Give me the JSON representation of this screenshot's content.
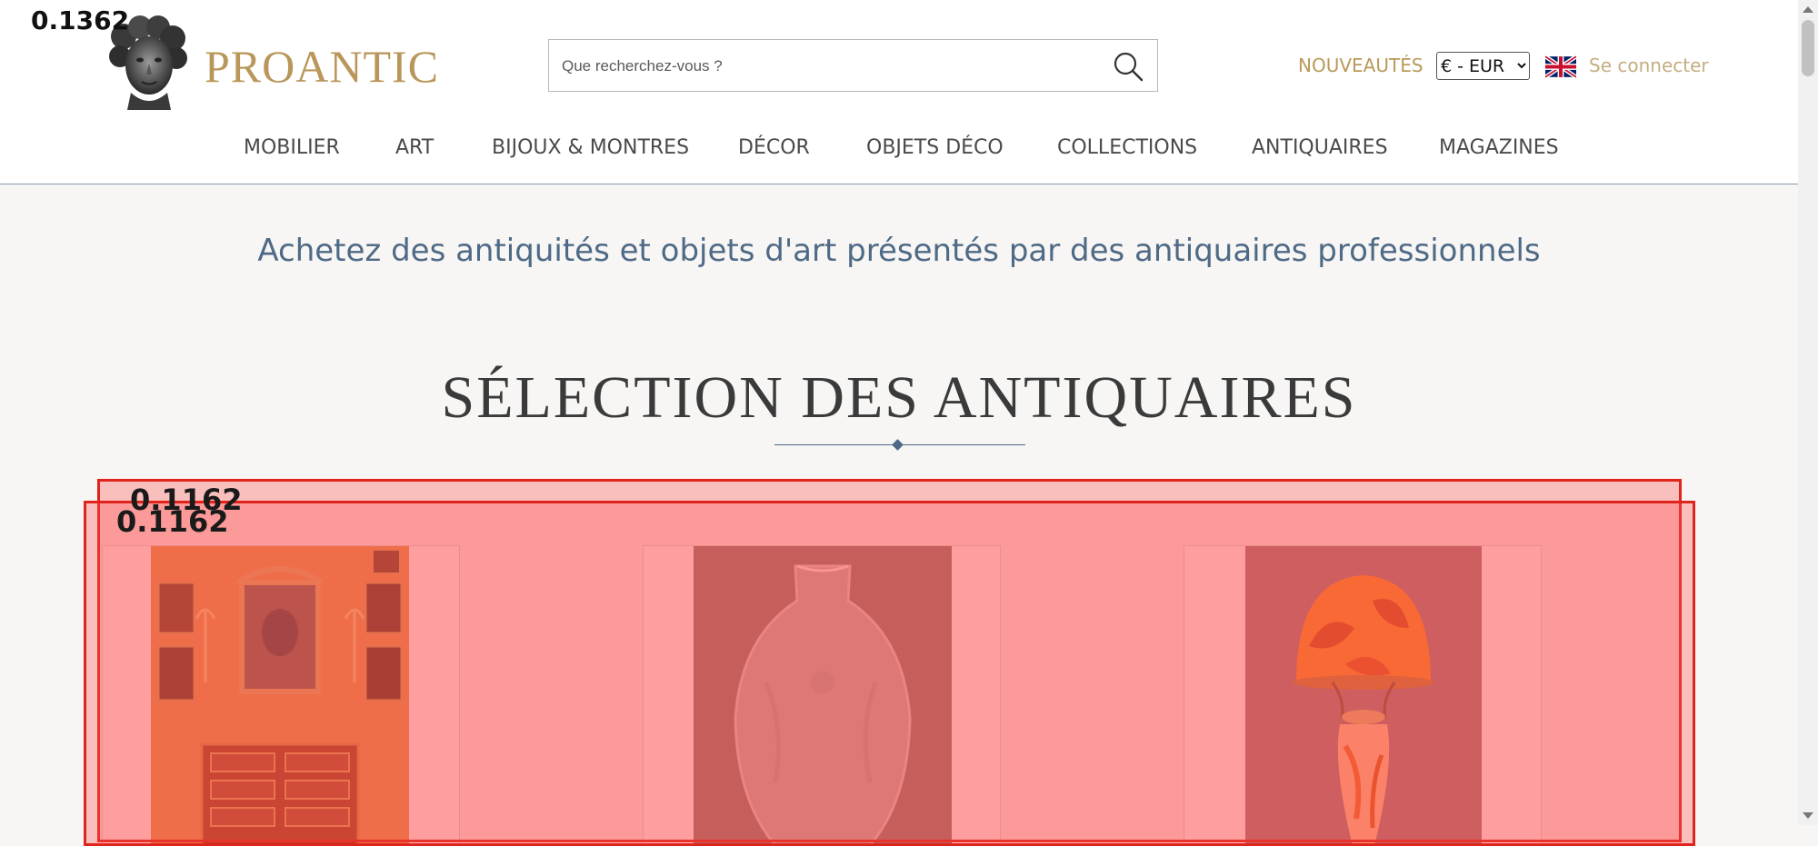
{
  "header": {
    "logo_text": "PROANTIC",
    "search_placeholder": "Que recherchez-vous ?",
    "new_label": "NOUVEAUTÉS",
    "currency_selected": "€ - EUR",
    "login_label": "Se connecter"
  },
  "nav": {
    "items": [
      {
        "label": "MOBILIER"
      },
      {
        "label": "ART"
      },
      {
        "label": "BIJOUX & MONTRES"
      },
      {
        "label": "DÉCOR"
      },
      {
        "label": "OBJETS DÉCO"
      },
      {
        "label": "COLLECTIONS"
      },
      {
        "label": "ANTIQUAIRES"
      },
      {
        "label": "MAGAZINES"
      }
    ]
  },
  "content": {
    "tagline": "Achetez des antiquités et objets d'art présentés par des antiquaires professionnels",
    "section_title": "SÉLECTION DES ANTIQUAIRES"
  },
  "overlay": {
    "corner_value": "0.1362",
    "box1_value": "0.1162",
    "box2_value": "0.1162"
  },
  "colors": {
    "accent_gold": "#b9965a",
    "heading_blue": "#4f6a86",
    "overlay_red": "#e0241b"
  }
}
